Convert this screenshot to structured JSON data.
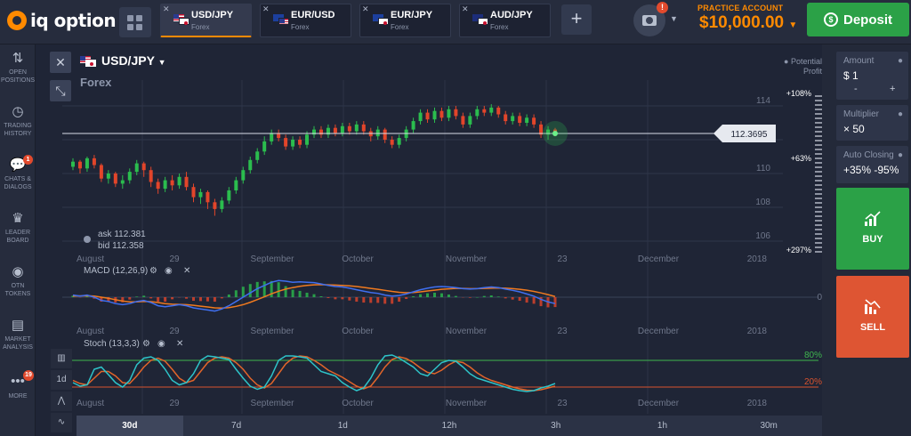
{
  "app": {
    "logo_text": "iq option"
  },
  "tabs": [
    {
      "pair": "USD/JPY",
      "type": "Forex",
      "active": true
    },
    {
      "pair": "EUR/USD",
      "type": "Forex",
      "active": false
    },
    {
      "pair": "EUR/JPY",
      "type": "Forex",
      "active": false
    },
    {
      "pair": "AUD/JPY",
      "type": "Forex",
      "active": false
    }
  ],
  "header": {
    "camera_badge": "!",
    "account_label": "PRACTICE ACCOUNT",
    "balance": "$10,000.00",
    "deposit_label": "Deposit"
  },
  "sidebar": {
    "items": [
      {
        "label1": "OPEN",
        "label2": "POSITIONS",
        "icon": "arrows-updown-icon"
      },
      {
        "label1": "TRADING",
        "label2": "HISTORY",
        "icon": "history-icon"
      },
      {
        "label1": "CHATS &",
        "label2": "DIALOGS",
        "icon": "chat-icon",
        "badge": "1"
      },
      {
        "label1": "LEADER",
        "label2": "BOARD",
        "icon": "trophy-icon"
      },
      {
        "label1": "OTN",
        "label2": "TOKENS",
        "icon": "token-icon"
      },
      {
        "label1": "MARKET",
        "label2": "ANALYSIS",
        "icon": "analysis-icon"
      },
      {
        "label1": "MORE",
        "label2": "",
        "icon": "more-icon",
        "badge": "19"
      }
    ]
  },
  "chart": {
    "pair": "USD/JPY",
    "asset_type": "Forex",
    "potential_profit_line1": "Potential",
    "potential_profit_line2": "Profit",
    "current_price": "112.3695",
    "ask": "ask 112.381",
    "bid": "bid 112.358",
    "macd_label": "MACD (12,26,9)",
    "stoch_label": "Stoch (13,3,3)",
    "profit_ticks": [
      "+108%",
      "+63%",
      "+297%"
    ],
    "price_ticks": [
      "114",
      "112",
      "110",
      "108",
      "106"
    ],
    "macd_zero": "0",
    "stoch_high": "80%",
    "stoch_low": "20%",
    "x_labels": [
      "August",
      "29",
      "September",
      "October",
      "November",
      "23",
      "December",
      "2018"
    ]
  },
  "timeframes": [
    "30d",
    "7d",
    "1d",
    "12h",
    "3h",
    "1h",
    "30m"
  ],
  "lower_tools": [
    "indicators-icon",
    "1d",
    "draw-icon",
    "chart-type-icon"
  ],
  "trade_panel": {
    "amount_label": "Amount",
    "amount_value": "$ 1",
    "minus": "-",
    "plus": "+",
    "multiplier_label": "Multiplier",
    "multiplier_value": "× 50",
    "auto_closing_label": "Auto Closing",
    "auto_closing_value": "+35% -95%",
    "buy_label": "BUY",
    "sell_label": "SELL"
  },
  "chart_data": {
    "type": "candlestick",
    "pair": "USD/JPY",
    "ylim": [
      105,
      115
    ],
    "y_ticks": [
      106,
      108,
      110,
      112,
      114
    ],
    "current_price": 112.3695,
    "candles": [
      {
        "o": 110.4,
        "c": 110.7,
        "h": 110.9,
        "l": 110.2
      },
      {
        "o": 110.7,
        "c": 110.3,
        "h": 110.8,
        "l": 110.0
      },
      {
        "o": 110.3,
        "c": 110.9,
        "h": 111.0,
        "l": 110.1
      },
      {
        "o": 110.9,
        "c": 110.5,
        "h": 111.1,
        "l": 110.3
      },
      {
        "o": 110.5,
        "c": 109.7,
        "h": 110.6,
        "l": 109.5
      },
      {
        "o": 109.7,
        "c": 110.0,
        "h": 110.2,
        "l": 109.4
      },
      {
        "o": 110.0,
        "c": 109.4,
        "h": 110.1,
        "l": 109.2
      },
      {
        "o": 109.4,
        "c": 109.6,
        "h": 109.9,
        "l": 109.1
      },
      {
        "o": 109.6,
        "c": 110.1,
        "h": 110.3,
        "l": 109.4
      },
      {
        "o": 110.1,
        "c": 110.6,
        "h": 110.8,
        "l": 109.9
      },
      {
        "o": 110.6,
        "c": 110.2,
        "h": 110.7,
        "l": 109.8
      },
      {
        "o": 110.2,
        "c": 109.5,
        "h": 110.4,
        "l": 109.2
      },
      {
        "o": 109.5,
        "c": 109.1,
        "h": 109.7,
        "l": 108.8
      },
      {
        "o": 109.1,
        "c": 109.6,
        "h": 109.8,
        "l": 108.9
      },
      {
        "o": 109.6,
        "c": 109.3,
        "h": 109.9,
        "l": 109.0
      },
      {
        "o": 109.3,
        "c": 109.8,
        "h": 110.0,
        "l": 109.1
      },
      {
        "o": 109.8,
        "c": 109.2,
        "h": 110.1,
        "l": 109.0
      },
      {
        "o": 109.2,
        "c": 108.6,
        "h": 109.4,
        "l": 108.3
      },
      {
        "o": 108.6,
        "c": 108.9,
        "h": 109.1,
        "l": 108.2
      },
      {
        "o": 108.9,
        "c": 108.3,
        "h": 109.0,
        "l": 107.9
      },
      {
        "o": 108.3,
        "c": 107.9,
        "h": 108.5,
        "l": 107.5
      },
      {
        "o": 107.9,
        "c": 108.4,
        "h": 108.6,
        "l": 107.7
      },
      {
        "o": 108.4,
        "c": 109.0,
        "h": 109.2,
        "l": 108.2
      },
      {
        "o": 109.0,
        "c": 109.6,
        "h": 109.8,
        "l": 108.8
      },
      {
        "o": 109.6,
        "c": 110.2,
        "h": 110.4,
        "l": 109.4
      },
      {
        "o": 110.2,
        "c": 110.8,
        "h": 111.0,
        "l": 110.0
      },
      {
        "o": 110.8,
        "c": 111.3,
        "h": 111.5,
        "l": 110.6
      },
      {
        "o": 111.3,
        "c": 111.9,
        "h": 112.2,
        "l": 111.1
      },
      {
        "o": 111.9,
        "c": 112.4,
        "h": 112.6,
        "l": 111.7
      },
      {
        "o": 112.4,
        "c": 112.1,
        "h": 112.6,
        "l": 111.9
      },
      {
        "o": 112.1,
        "c": 111.6,
        "h": 112.3,
        "l": 111.4
      },
      {
        "o": 111.6,
        "c": 112.0,
        "h": 112.2,
        "l": 111.4
      },
      {
        "o": 112.0,
        "c": 111.7,
        "h": 112.2,
        "l": 111.5
      },
      {
        "o": 111.7,
        "c": 112.3,
        "h": 112.5,
        "l": 111.5
      },
      {
        "o": 112.3,
        "c": 112.6,
        "h": 112.8,
        "l": 112.1
      },
      {
        "o": 112.6,
        "c": 112.3,
        "h": 112.8,
        "l": 112.1
      },
      {
        "o": 112.3,
        "c": 112.7,
        "h": 112.9,
        "l": 112.1
      },
      {
        "o": 112.7,
        "c": 112.4,
        "h": 112.9,
        "l": 112.2
      },
      {
        "o": 112.4,
        "c": 112.8,
        "h": 113.0,
        "l": 112.2
      },
      {
        "o": 112.8,
        "c": 112.5,
        "h": 113.0,
        "l": 112.3
      },
      {
        "o": 112.5,
        "c": 112.9,
        "h": 113.1,
        "l": 112.3
      },
      {
        "o": 112.9,
        "c": 112.5,
        "h": 113.1,
        "l": 112.3
      },
      {
        "o": 112.5,
        "c": 112.2,
        "h": 112.7,
        "l": 111.9
      },
      {
        "o": 112.2,
        "c": 112.6,
        "h": 112.8,
        "l": 112.0
      },
      {
        "o": 112.6,
        "c": 112.0,
        "h": 112.7,
        "l": 111.8
      },
      {
        "o": 112.0,
        "c": 111.7,
        "h": 112.2,
        "l": 111.5
      },
      {
        "o": 111.7,
        "c": 112.1,
        "h": 112.3,
        "l": 111.5
      },
      {
        "o": 112.1,
        "c": 112.6,
        "h": 112.8,
        "l": 111.9
      },
      {
        "o": 112.6,
        "c": 113.1,
        "h": 113.3,
        "l": 112.4
      },
      {
        "o": 113.1,
        "c": 113.6,
        "h": 113.8,
        "l": 112.9
      },
      {
        "o": 113.6,
        "c": 113.2,
        "h": 113.8,
        "l": 113.0
      },
      {
        "o": 113.2,
        "c": 113.7,
        "h": 113.9,
        "l": 113.0
      },
      {
        "o": 113.7,
        "c": 113.3,
        "h": 113.9,
        "l": 113.1
      },
      {
        "o": 113.3,
        "c": 113.8,
        "h": 114.0,
        "l": 113.1
      },
      {
        "o": 113.8,
        "c": 113.4,
        "h": 114.0,
        "l": 113.2
      },
      {
        "o": 113.4,
        "c": 112.9,
        "h": 113.6,
        "l": 112.7
      },
      {
        "o": 112.9,
        "c": 113.4,
        "h": 113.6,
        "l": 112.7
      },
      {
        "o": 113.4,
        "c": 113.8,
        "h": 114.0,
        "l": 113.2
      },
      {
        "o": 113.8,
        "c": 113.6,
        "h": 114.0,
        "l": 113.4
      },
      {
        "o": 113.6,
        "c": 113.9,
        "h": 114.1,
        "l": 113.4
      },
      {
        "o": 113.9,
        "c": 113.5,
        "h": 114.0,
        "l": 113.3
      },
      {
        "o": 113.5,
        "c": 113.1,
        "h": 113.7,
        "l": 112.9
      },
      {
        "o": 113.1,
        "c": 113.4,
        "h": 113.6,
        "l": 112.9
      },
      {
        "o": 113.4,
        "c": 113.0,
        "h": 113.6,
        "l": 112.8
      },
      {
        "o": 113.0,
        "c": 113.3,
        "h": 113.5,
        "l": 112.8
      },
      {
        "o": 113.3,
        "c": 112.9,
        "h": 113.5,
        "l": 112.7
      },
      {
        "o": 112.9,
        "c": 112.3,
        "h": 113.1,
        "l": 112.1
      },
      {
        "o": 112.3,
        "c": 112.6,
        "h": 112.8,
        "l": 112.0
      },
      {
        "o": 112.6,
        "c": 112.37,
        "h": 112.7,
        "l": 112.2
      }
    ],
    "macd_line": [
      0.1,
      0.05,
      0.1,
      0.0,
      -0.15,
      -0.2,
      -0.3,
      -0.35,
      -0.3,
      -0.2,
      -0.15,
      -0.25,
      -0.4,
      -0.45,
      -0.4,
      -0.35,
      -0.4,
      -0.5,
      -0.55,
      -0.6,
      -0.65,
      -0.55,
      -0.4,
      -0.2,
      0.0,
      0.2,
      0.4,
      0.55,
      0.7,
      0.78,
      0.75,
      0.7,
      0.72,
      0.7,
      0.68,
      0.62,
      0.55,
      0.5,
      0.48,
      0.42,
      0.35,
      0.28,
      0.22,
      0.18,
      0.1,
      0.05,
      0.08,
      0.15,
      0.25,
      0.35,
      0.42,
      0.48,
      0.5,
      0.48,
      0.45,
      0.4,
      0.38,
      0.4,
      0.45,
      0.48,
      0.45,
      0.38,
      0.32,
      0.25,
      0.15,
      0.05,
      -0.1,
      -0.22,
      -0.3
    ],
    "macd_signal": [
      0.05,
      0.06,
      0.07,
      0.05,
      0.0,
      -0.05,
      -0.12,
      -0.18,
      -0.22,
      -0.22,
      -0.2,
      -0.21,
      -0.25,
      -0.3,
      -0.33,
      -0.34,
      -0.35,
      -0.38,
      -0.42,
      -0.46,
      -0.5,
      -0.51,
      -0.49,
      -0.43,
      -0.35,
      -0.24,
      -0.11,
      0.02,
      0.16,
      0.28,
      0.38,
      0.45,
      0.51,
      0.55,
      0.58,
      0.59,
      0.58,
      0.57,
      0.55,
      0.53,
      0.5,
      0.46,
      0.41,
      0.37,
      0.32,
      0.27,
      0.23,
      0.21,
      0.22,
      0.25,
      0.29,
      0.33,
      0.37,
      0.39,
      0.41,
      0.41,
      0.4,
      0.4,
      0.41,
      0.42,
      0.43,
      0.42,
      0.4,
      0.37,
      0.33,
      0.27,
      0.2,
      0.12,
      0.03
    ],
    "stoch_k": [
      30,
      22,
      25,
      60,
      65,
      48,
      30,
      20,
      35,
      70,
      85,
      88,
      80,
      60,
      35,
      25,
      30,
      50,
      80,
      90,
      88,
      85,
      82,
      60,
      40,
      22,
      15,
      20,
      45,
      80,
      90,
      90,
      88,
      85,
      70,
      55,
      50,
      45,
      30,
      20,
      12,
      18,
      40,
      70,
      90,
      92,
      85,
      75,
      65,
      50,
      45,
      60,
      75,
      80,
      78,
      65,
      50,
      40,
      35,
      30,
      25,
      20,
      15,
      12,
      10,
      12,
      18,
      22,
      28
    ],
    "stoch_d": [
      35,
      28,
      25,
      40,
      55,
      55,
      45,
      30,
      28,
      45,
      65,
      80,
      85,
      78,
      60,
      40,
      30,
      35,
      55,
      75,
      85,
      88,
      85,
      75,
      60,
      40,
      25,
      18,
      28,
      50,
      72,
      85,
      90,
      88,
      80,
      70,
      58,
      50,
      42,
      32,
      22,
      16,
      22,
      42,
      65,
      82,
      88,
      84,
      75,
      63,
      53,
      50,
      58,
      70,
      78,
      75,
      65,
      52,
      42,
      35,
      30,
      25,
      20,
      16,
      13,
      12,
      14,
      18,
      22
    ],
    "stoch_levels": [
      80,
      20
    ]
  }
}
